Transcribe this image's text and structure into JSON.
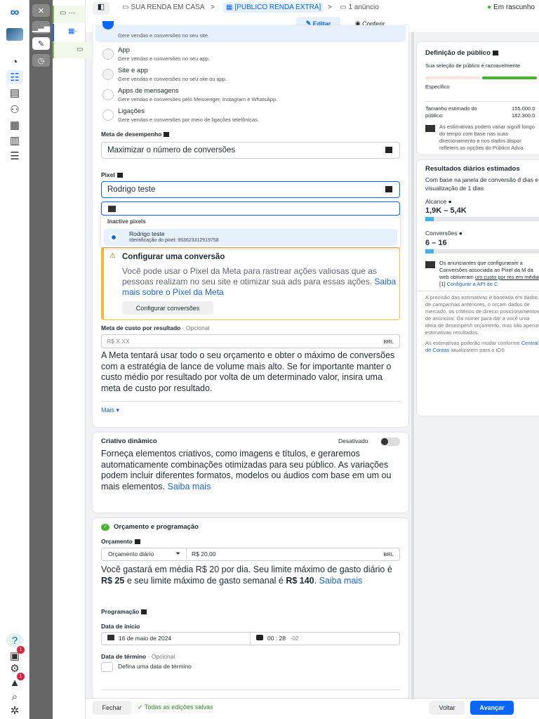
{
  "header": {
    "campaign": "SUA RENDA EM CASA",
    "adset": "[PUBLICO RENDA EXTRA]",
    "ad": "1 anúncio",
    "status": "Em rascunho",
    "edit": "Editar",
    "review": "Conferir"
  },
  "conversion": {
    "options": [
      {
        "title": "",
        "sub": "Gere vendas e conversões no seu site."
      },
      {
        "title": "App",
        "sub": "Gere vendas e conversões no seu app."
      },
      {
        "title": "Site e app",
        "sub": "Gere vendas e conversões no seu site ou app."
      },
      {
        "title": "Apps de mensagens",
        "sub": "Gere vendas e conversões pelo Messenger, Instagram e WhatsApp."
      },
      {
        "title": "Ligações",
        "sub": "Gere vendas e conversões por meio de ligações telefônicas."
      }
    ],
    "goal_label": "Meta de desempenho",
    "goal_value": "Maximizar o número de conversões",
    "pixel_label": "Pixel",
    "pixel_value": "Rodrigo teste",
    "dropdown": {
      "group": "Inactive pixels",
      "item_name": "Rodrigo teste",
      "item_id": "Identificação do pixel: 953623312919758"
    },
    "warn": {
      "title": "Configurar uma conversão",
      "text": "Você pode usar o Pixel da Meta para rastrear ações valiosas que as pessoas realizam no seu site e otimizar sua ads para essas ações. ",
      "link": "Saiba mais sobre o Pixel da Meta",
      "button": "Configurar conversões"
    },
    "cost_label": "Meta de custo por resultado",
    "optional": "· Opcional",
    "cost_placeholder": "R$ X.XX",
    "currency": "BRL",
    "cost_help": "A Meta tentará usar todo o seu orçamento e obter o máximo de conversões com a estratégia de lance de volume mais alto. Se for importante manter o custo médio por resultado por volta de um determinado valor, insira uma meta de custo por resultado.",
    "more": "Mais"
  },
  "dynamic": {
    "title": "Criativo dinâmico",
    "toggle_label": "Desativado",
    "text": "Forneça elementos criativos, como imagens e títulos, e geraremos automaticamente combinações otimizadas para seu público. As variações podem incluir diferentes formatos, modelos ou áudios com base em um ou mais elementos. ",
    "link": "Saiba mais"
  },
  "budget": {
    "title": "Orçamento e programação",
    "label": "Orçamento",
    "type": "Orçamento diário",
    "amount": "R$ 20,00",
    "currency": "BRL",
    "t1": "Você gastará em média R$ 20 por dia. Seu limite máximo de gasto diário é ",
    "b1": "R$ 25",
    "t2": " e seu limite máximo de gasto semanal é ",
    "b2": "R$ 140",
    "t3": ". ",
    "link": "Saiba mais",
    "schedule": "Programação",
    "start_label": "Data de início",
    "start_date": "16 de maio de 2024",
    "start_time": "00 : 28",
    "tz": "-02",
    "end_label": "Data de término",
    "end_opt": "· Opcional",
    "end_check": "Defina uma data de término"
  },
  "audience": {
    "title": "Definição de público",
    "desc": "Sua seleção de público é razoavelmente",
    "specific": "Específico",
    "size_label": "Tamanho estimado do público:",
    "size_value": "155.000.0 182.300.0",
    "note": "As estimativas podem variar signifi longo do tempo com base nas suas direcionamento e nos dados dispor refletem as opções do Público Adva"
  },
  "results": {
    "title": "Resultados diários estimados",
    "desc": "Com base na janela de conversão d dias e visualização de 1 dias",
    "reach_label": "Alcance",
    "reach": "1,9K – 5,4K",
    "conv_label": "Conversões",
    "conv": "6 – 16",
    "note1": "Os anunciantes que configuraram a Conversões associada ao Pixel da M da web obtiveram ",
    "note_u": "um custo por res em média.",
    "note_ref": " [1] ",
    "note_link": "Configurar a API de C",
    "disc1": "A precisão das estimativas é baseada em dados de campanhas anteriores, o orçam dados de mercado, os critérios de direcio posicionamentos de anúncios. Os númer para dar a você uma ideia de desempenh orçamento, mas são apenas estimativas resultados.",
    "disc2": "As estimativas poderão mudar conforme ",
    "disc2_link": "Central de Contas",
    "disc2_end": " atualizarem para o iOS"
  },
  "footer": {
    "close": "Fechar",
    "saved": "Todas as edições salvas",
    "back": "Voltar",
    "next": "Avançar"
  },
  "badges": {
    "a": "1",
    "b": "1"
  },
  "colors": {
    "accent": "#0866ff",
    "green": "#42b72a"
  }
}
